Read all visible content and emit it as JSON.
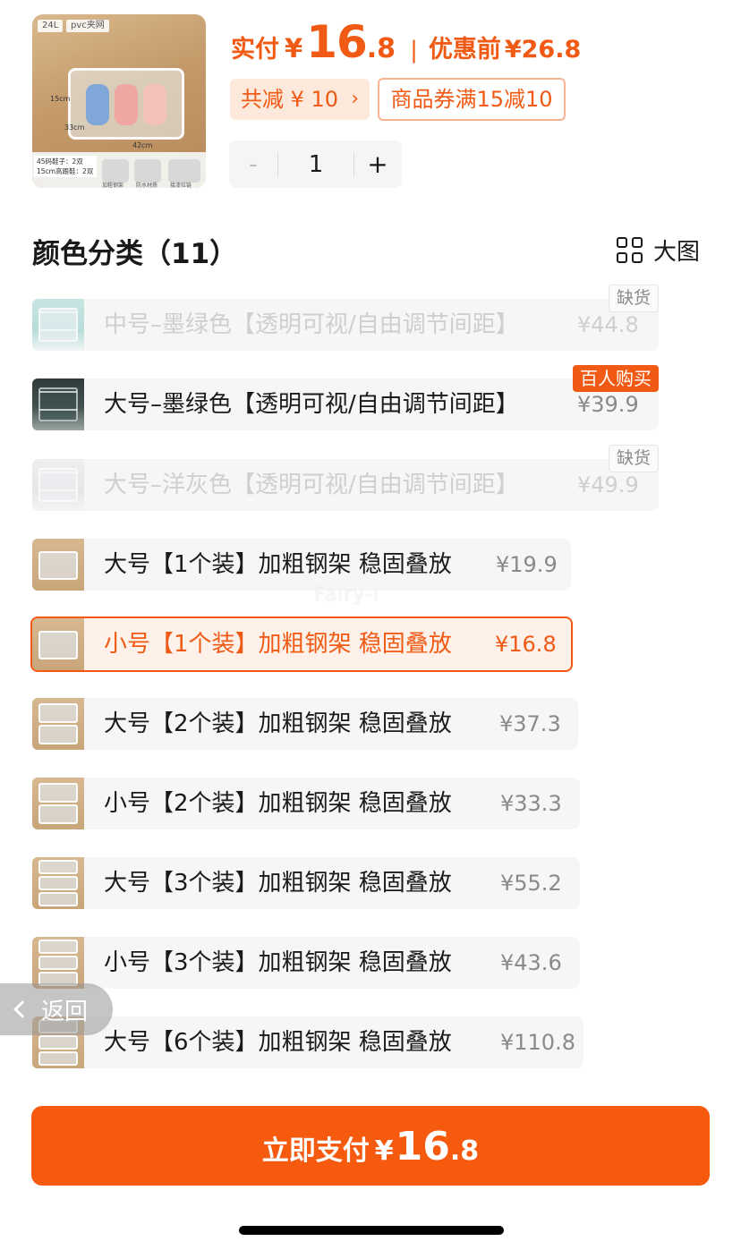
{
  "product": {
    "thumb_tags": [
      "24L",
      "pvc夹网"
    ],
    "thumb_captions": [
      "45码鞋子：2双",
      "15cm高跟鞋：2双"
    ],
    "thumb_dims": [
      "15cm",
      "33cm",
      "42cm"
    ],
    "thumb_features": [
      "加粗钢架",
      "防水材质",
      "接漆拉链"
    ]
  },
  "price": {
    "paid_label": "实付",
    "currency": "¥",
    "paid_int": "16",
    "paid_dec": ".8",
    "separator": "|",
    "original_label": "优惠前",
    "original_price": "¥26.8"
  },
  "discount_chip": {
    "label": "共减 ¥ 10",
    "arrow": "›"
  },
  "coupon_chip": {
    "label": "商品券满15减10"
  },
  "stepper": {
    "minus": "-",
    "quantity": "1",
    "plus": "+"
  },
  "section": {
    "title": "颜色分类（11）",
    "big_view_label": "大图"
  },
  "options": [
    {
      "label": "中号–墨绿色【透明可视/自由调节间距】",
      "price": "¥44.8",
      "badge": "缺货",
      "state": "disabled"
    },
    {
      "label": "大号–墨绿色【透明可视/自由调节间距】",
      "price": "¥39.9",
      "badge": "百人购买",
      "state": "normal"
    },
    {
      "label": "大号–洋灰色【透明可视/自由调节间距】",
      "price": "¥49.9",
      "badge": "缺货",
      "state": "disabled"
    },
    {
      "label": "大号【1个装】加粗钢架 稳固叠放",
      "price": "¥19.9",
      "badge": "",
      "state": "normal"
    },
    {
      "label": "小号【1个装】加粗钢架 稳固叠放",
      "price": "¥16.8",
      "badge": "",
      "state": "selected"
    },
    {
      "label": "大号【2个装】加粗钢架 稳固叠放",
      "price": "¥37.3",
      "badge": "",
      "state": "normal"
    },
    {
      "label": "小号【2个装】加粗钢架 稳固叠放",
      "price": "¥33.3",
      "badge": "",
      "state": "normal"
    },
    {
      "label": "大号【3个装】加粗钢架 稳固叠放",
      "price": "¥55.2",
      "badge": "",
      "state": "normal"
    },
    {
      "label": "小号【3个装】加粗钢架 稳固叠放",
      "price": "¥43.6",
      "badge": "",
      "state": "normal"
    },
    {
      "label": "大号【6个装】加粗钢架 稳固叠放",
      "price": "¥110.8",
      "badge": "",
      "state": "normal"
    }
  ],
  "watermark": "Fairy-i",
  "back_button": {
    "label": "返回",
    "icon": "chevron-left-icon"
  },
  "pay_button": {
    "label": "立即支付",
    "currency": "¥",
    "amount_int": "16",
    "amount_dec": ".8"
  },
  "colors": {
    "accent": "#f05a14",
    "pay_button": "#f65a0f",
    "row_bg": "#f6f6f6"
  }
}
